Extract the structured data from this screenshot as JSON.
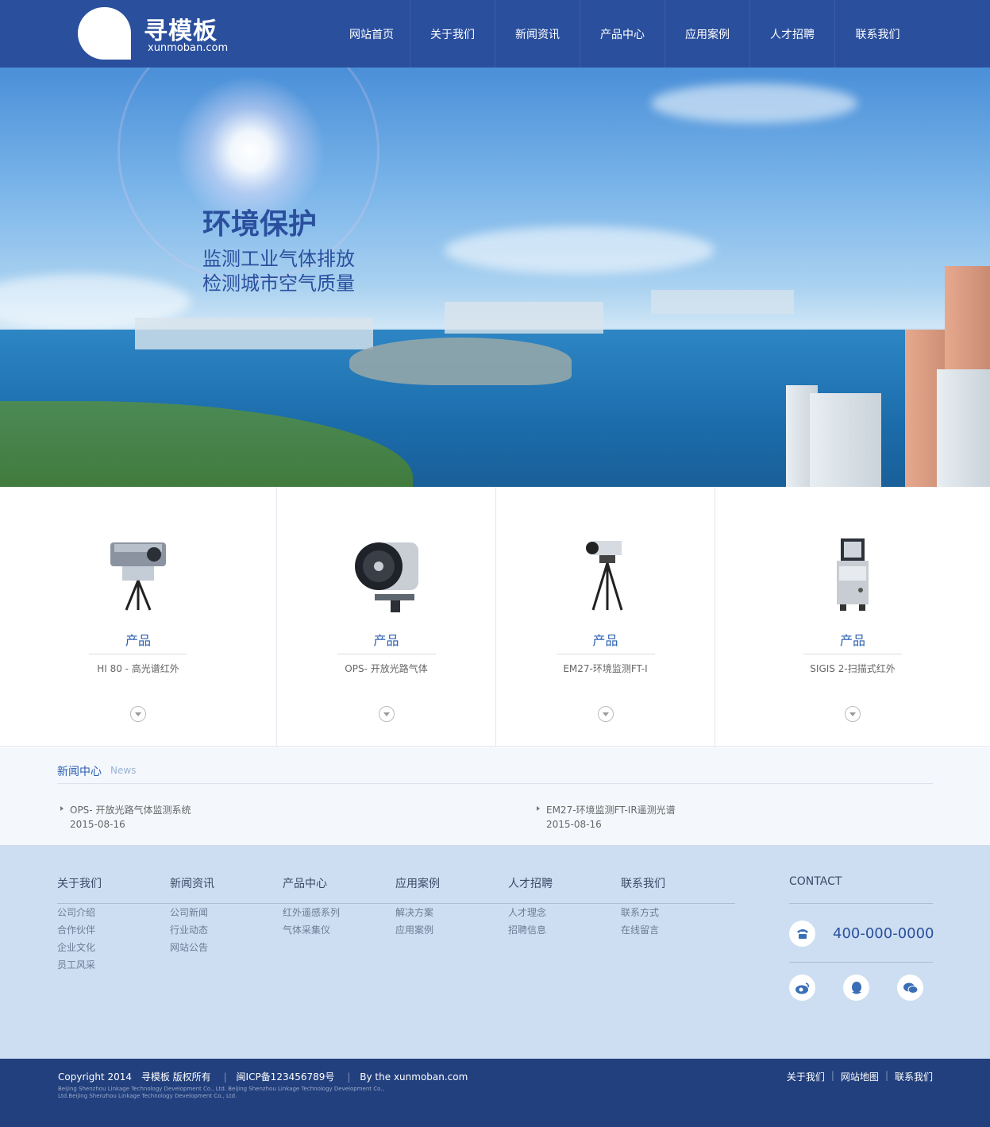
{
  "header": {
    "logo_cn": "寻模板",
    "logo_en": "xunmoban.com",
    "nav": [
      "网站首页",
      "关于我们",
      "新闻资讯",
      "产品中心",
      "应用案例",
      "人才招聘",
      "联系我们"
    ]
  },
  "banner": {
    "title": "环境保护",
    "line1": "监测工业气体排放",
    "line2": "检测城市空气质量"
  },
  "products": [
    {
      "label": "产品",
      "name": "HI 80 - 高光谱红外"
    },
    {
      "label": "产品",
      "name": "OPS- 开放光路气体"
    },
    {
      "label": "产品",
      "name": "EM27-环境监测FT-I"
    },
    {
      "label": "产品",
      "name": "SIGIS 2-扫描式红外"
    }
  ],
  "news": {
    "title": "新闻中心",
    "subtitle": "News",
    "items": [
      {
        "title": "OPS- 开放光路气体监测系统",
        "date": "2015-08-16"
      },
      {
        "title": "EM27-环境监测FT-IR遥测光谱",
        "date": "2015-08-16"
      }
    ]
  },
  "footer": {
    "columns": [
      {
        "title": "关于我们",
        "links": [
          "公司介绍",
          "合作伙伴",
          "企业文化",
          "员工风采"
        ]
      },
      {
        "title": "新闻资讯",
        "links": [
          "公司新闻",
          "行业动态",
          "网站公告"
        ]
      },
      {
        "title": "产品中心",
        "links": [
          "红外遥感系列",
          "气体采集仪"
        ]
      },
      {
        "title": "应用案例",
        "links": [
          "解决方案",
          "应用案例"
        ]
      },
      {
        "title": "人才招聘",
        "links": [
          "人才理念",
          "招聘信息"
        ]
      },
      {
        "title": "联系我们",
        "links": [
          "联系方式",
          "在线留言"
        ]
      }
    ],
    "contact_title": "CONTACT",
    "phone": "400-000-0000",
    "social_icons": [
      "weibo-icon",
      "qq-icon",
      "wechat-icon"
    ]
  },
  "bottom": {
    "copyright": "Copyright 2014",
    "owner": "寻模板 版权所有",
    "icp": "闽ICP备123456789号",
    "by": "By the xunmoban.com",
    "small_text": "Beijing Shenzhou Linkage Technology Development Co., Ltd. Beijing Shenzhou Linkage Technology Development Co., Ltd.Beijing Shenzhou Linkage Technology Development Co., Ltd.",
    "links": [
      "关于我们",
      "网站地图",
      "联系我们"
    ]
  },
  "colors": {
    "brand": "#2a4f9d",
    "footer_bg": "#cddef2",
    "bottom_bg": "#22407e"
  }
}
